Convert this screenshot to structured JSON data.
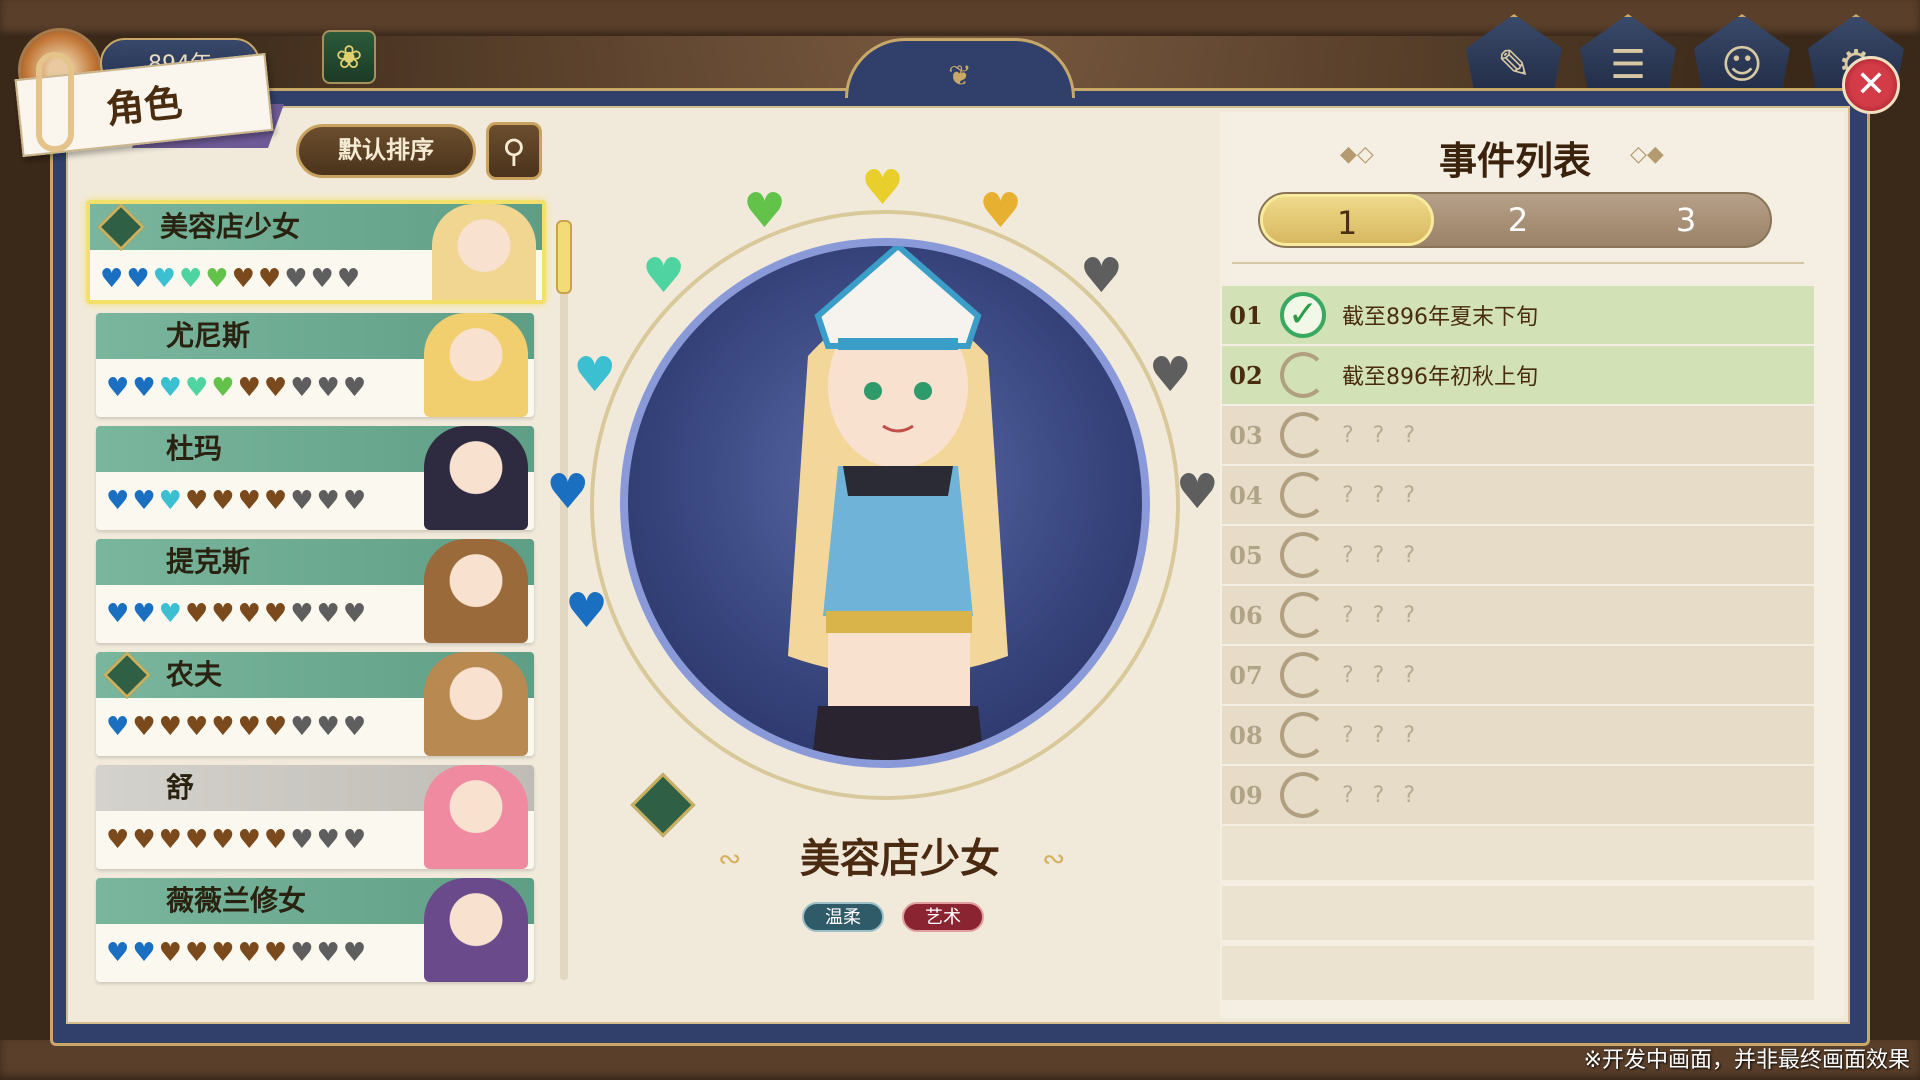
{
  "hud": {
    "year": "894年",
    "buttons": [
      "quill-icon",
      "quest-board-icon",
      "characters-icon",
      "settings-gear-icon"
    ]
  },
  "tab": {
    "label": "角色"
  },
  "sort": {
    "label": "默认排序"
  },
  "colors": {
    "heart_blue": "#1a6fc0",
    "heart_cyan": "#3cbfd0",
    "heart_mint": "#4fd3a0",
    "heart_green": "#62c24a",
    "heart_yellow": "#e9cf2c",
    "heart_gold": "#e8b030",
    "heart_brown": "#7a4a1c",
    "heart_grey": "#5e5e5e"
  },
  "characters": [
    {
      "name": "美容店少女",
      "emblem": true,
      "selected": true,
      "band": "green",
      "hearts": [
        "blue",
        "blue",
        "cyan",
        "mint",
        "green",
        "brown",
        "brown",
        "grey",
        "grey",
        "grey"
      ]
    },
    {
      "name": "尤尼斯",
      "emblem": false,
      "selected": false,
      "band": "green",
      "hearts": [
        "blue",
        "blue",
        "cyan",
        "mint",
        "green",
        "brown",
        "brown",
        "grey",
        "grey",
        "grey"
      ]
    },
    {
      "name": "杜玛",
      "emblem": false,
      "selected": false,
      "band": "green",
      "hearts": [
        "blue",
        "blue",
        "cyan",
        "brown",
        "brown",
        "brown",
        "brown",
        "grey",
        "grey",
        "grey"
      ]
    },
    {
      "name": "提克斯",
      "emblem": false,
      "selected": false,
      "band": "green",
      "hearts": [
        "blue",
        "blue",
        "cyan",
        "brown",
        "brown",
        "brown",
        "brown",
        "grey",
        "grey",
        "grey"
      ]
    },
    {
      "name": "农夫",
      "emblem": true,
      "selected": false,
      "band": "green",
      "hearts": [
        "blue",
        "brown",
        "brown",
        "brown",
        "brown",
        "brown",
        "brown",
        "grey",
        "grey",
        "grey"
      ]
    },
    {
      "name": "舒",
      "emblem": false,
      "selected": false,
      "band": "grey",
      "hearts": [
        "brown",
        "brown",
        "brown",
        "brown",
        "brown",
        "brown",
        "brown",
        "grey",
        "grey",
        "grey"
      ]
    },
    {
      "name": "薇薇兰修女",
      "emblem": false,
      "selected": false,
      "band": "green",
      "hearts": [
        "blue",
        "blue",
        "brown",
        "brown",
        "brown",
        "brown",
        "brown",
        "grey",
        "grey",
        "grey"
      ]
    }
  ],
  "selected_character": {
    "name": "美容店少女",
    "traits": [
      "温柔",
      "艺术"
    ],
    "affection_hearts": [
      "blue",
      "blue",
      "cyan",
      "mint",
      "green",
      "yellow",
      "gold",
      "grey",
      "grey",
      "grey"
    ]
  },
  "events": {
    "title": "事件列表",
    "pages": [
      "1",
      "2",
      "3"
    ],
    "active_page": "1",
    "rows": [
      {
        "num": "01",
        "status": "done",
        "text": "截至896年夏末下旬"
      },
      {
        "num": "02",
        "status": "in-progress",
        "text": "截至896年初秋上旬"
      },
      {
        "num": "03",
        "status": "locked",
        "text": "? ? ?"
      },
      {
        "num": "04",
        "status": "locked",
        "text": "? ? ?"
      },
      {
        "num": "05",
        "status": "locked",
        "text": "? ? ?"
      },
      {
        "num": "06",
        "status": "locked",
        "text": "? ? ?"
      },
      {
        "num": "07",
        "status": "locked",
        "text": "? ? ?"
      },
      {
        "num": "08",
        "status": "locked",
        "text": "? ? ?"
      },
      {
        "num": "09",
        "status": "locked",
        "text": "? ? ?"
      }
    ]
  },
  "footer": {
    "note": "※开发中画面，并非最终画面效果"
  }
}
